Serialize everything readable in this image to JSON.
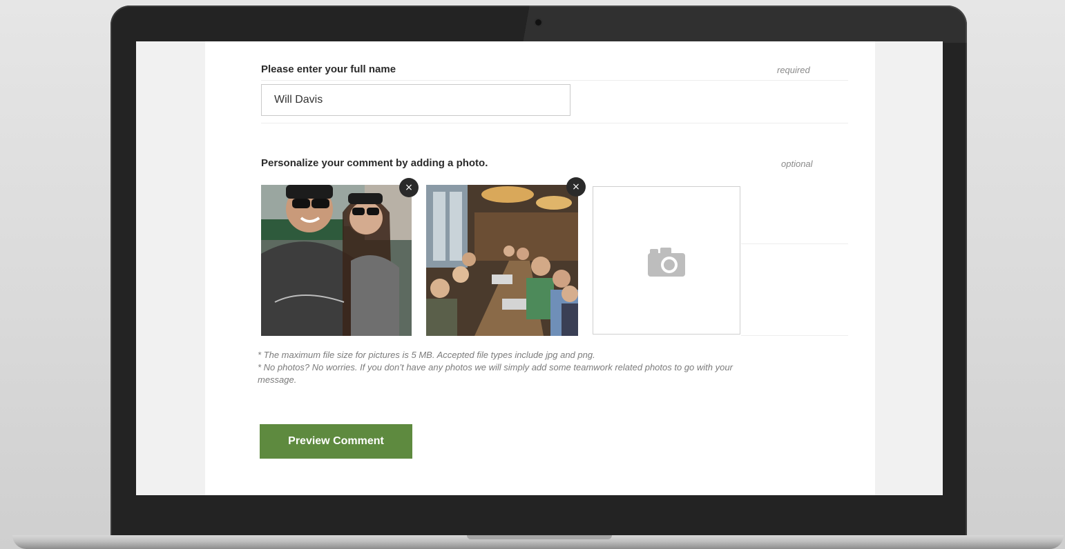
{
  "name_field": {
    "label": "Please enter your full name",
    "hint": "required",
    "value": "Will Davis"
  },
  "photo_section": {
    "label": "Personalize your comment by adding a photo.",
    "hint": "optional",
    "remove_symbol": "×",
    "photos": [
      {
        "subject": "selfie of two people wearing sunglasses"
      },
      {
        "subject": "group of people at a long restaurant table"
      }
    ],
    "add_photo_icon": "camera-icon"
  },
  "notes": {
    "line1": "* The maximum file size for pictures is 5 MB. Accepted file types include jpg and png.",
    "line2": "* No photos? No worries. If you don’t have any photos we will simply add some teamwork related photos to go with your message."
  },
  "actions": {
    "preview_label": "Preview Comment"
  },
  "colors": {
    "accent": "#5e8a3f",
    "remove_button": "#2a2a2a",
    "laptop_bezel": "#232323"
  }
}
